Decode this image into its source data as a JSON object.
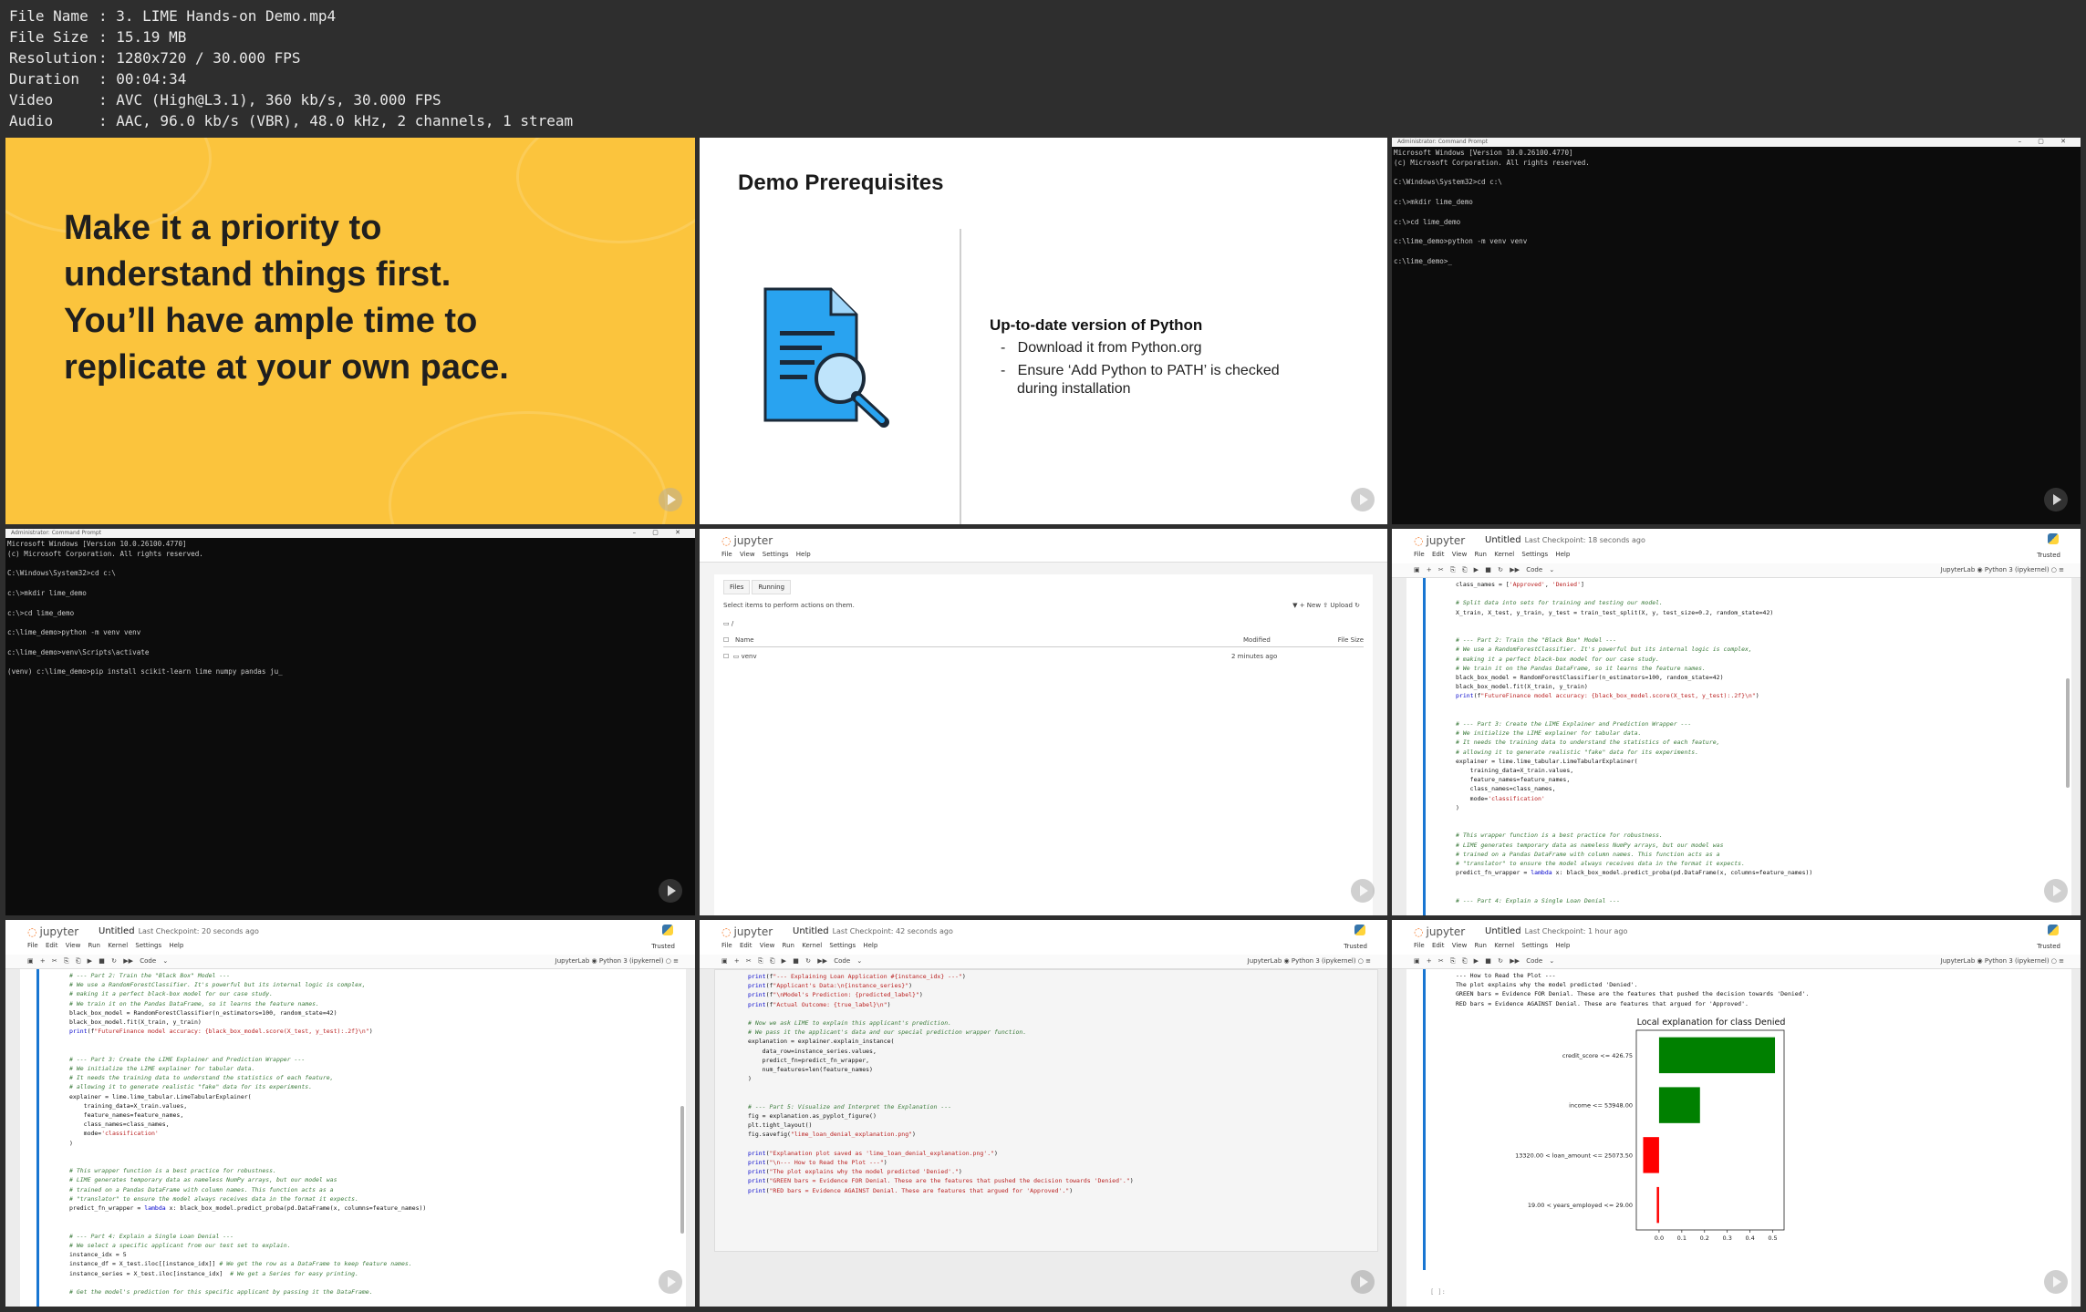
{
  "info": {
    "file_name_label": "File Name",
    "file_name": "3. LIME Hands-on Demo.mp4",
    "file_size_label": "File Size",
    "file_size": "15.19 MB",
    "resolution_label": "Resolution",
    "resolution": "1280x720 / 30.000 FPS",
    "duration_label": "Duration",
    "duration": "00:04:34",
    "video_label": "Video",
    "video": "AVC (High@L3.1), 360 kb/s, 30.000 FPS",
    "audio_label": "Audio",
    "audio": "AAC, 96.0 kb/s (VBR), 48.0 kHz, 2 channels, 1 stream"
  },
  "slide1": {
    "text": "Make it a priority to\nunderstand things first.\nYou’ll have ample time to\nreplicate at your own pace."
  },
  "slide2": {
    "title": "Demo Prerequisites",
    "heading": "Up-to-date version of Python",
    "bullet1": "Download it from Python.org",
    "bullet2": "Ensure ‘Add Python to PATH’ is checked",
    "bullet2b": "during installation"
  },
  "terminal1": {
    "title": "Administrator: Command Prompt",
    "text": "Microsoft Windows [Version 10.0.26100.4770]\n(c) Microsoft Corporation. All rights reserved.\n\nC:\\Windows\\System32>cd c:\\\n\nc:\\>mkdir lime_demo\n\nc:\\>cd lime_demo\n\nc:\\lime_demo>python -m venv venv\n\nc:\\lime_demo>_"
  },
  "terminal2": {
    "title": "Administrator: Command Prompt",
    "text": "Microsoft Windows [Version 10.0.26100.4770]\n(c) Microsoft Corporation. All rights reserved.\n\nC:\\Windows\\System32>cd c:\\\n\nc:\\>mkdir lime_demo\n\nc:\\>cd lime_demo\n\nc:\\lime_demo>python -m venv venv\n\nc:\\lime_demo>venv\\Scripts\\activate\n\n(venv) c:\\lime_demo>pip install scikit-learn lime numpy pandas ju_"
  },
  "jupyter": {
    "logo": "jupyter",
    "menu": "File  Edit  View  Run  Kernel  Settings  Help",
    "menu_short": "File  View  Settings  Help",
    "trusted": "Trusted",
    "kernel": "JupyterLab  ◉  Python 3 (ipykernel)  ○  ≡",
    "toolbar": "▣ + ✂ ⎘ ⎗ ▶ ■ ↻ ▶▶  Code  ⌄",
    "nb_name": "Untitled"
  },
  "filebrowser": {
    "tab_files": "Files",
    "tab_running": "Running",
    "hint": "Select items to perform actions on them.",
    "actions": "▼   + New   ⇪ Upload   ↻",
    "path": "/",
    "col_name": "Name",
    "col_modified": "Modified",
    "col_size": "File Size",
    "row_name": "venv",
    "row_modified": "2 minutes ago"
  },
  "nb1": {
    "checkpoint": "Last Checkpoint: 18 seconds ago"
  },
  "nb2": {
    "checkpoint": "Last Checkpoint: 20 seconds ago"
  },
  "nb3": {
    "checkpoint": "Last Checkpoint: 42 seconds ago"
  },
  "nb4": {
    "checkpoint": "Last Checkpoint: 1 hour ago",
    "out1": "--- How to Read the Plot ---",
    "out2": "The plot explains why the model predicted 'Denied'.",
    "out3": "GREEN bars = Evidence FOR Denial. These are the features that pushed the decision towards 'Denied'.",
    "out4": "RED bars = Evidence AGAINST Denial. These are features that argued for 'Approved'.",
    "prompt": "[ ]:"
  },
  "chart_data": {
    "type": "bar",
    "orientation": "horizontal",
    "title": "Local explanation for class Denied",
    "categories": [
      "credit_score <= 426.75",
      "income <= 53948.00",
      "13320.00 < loan_amount <= 25073.50",
      "19.00 < years_employed <= 29.00"
    ],
    "values": [
      0.51,
      0.18,
      -0.07,
      -0.01
    ],
    "colors": [
      "#008000",
      "#008000",
      "#ff0000",
      "#ff0000"
    ],
    "xticks": [
      "0.0",
      "0.1",
      "0.2",
      "0.3",
      "0.4",
      "0.5"
    ],
    "xlim": [
      -0.1,
      0.55
    ]
  }
}
